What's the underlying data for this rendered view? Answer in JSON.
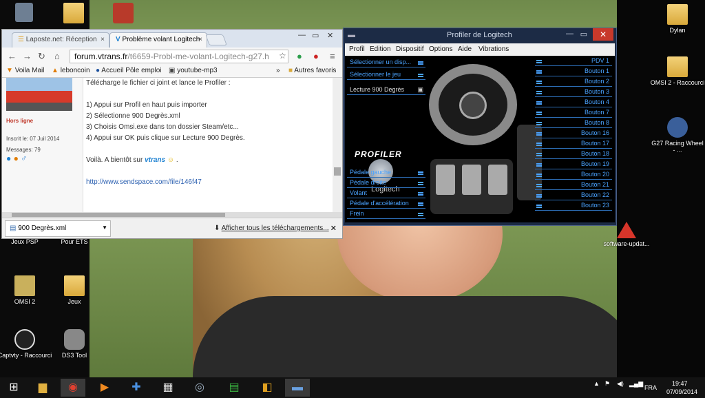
{
  "desktop": {
    "icons": [
      {
        "label": "Dylan"
      },
      {
        "label": "OMSI 2 - Raccourci"
      },
      {
        "label": "G27 Racing Wheel - ..."
      },
      {
        "label": "software-updat..."
      },
      {
        "label": "Jeux PSP"
      },
      {
        "label": "Pour ETS"
      },
      {
        "label": "OMSI 2"
      },
      {
        "label": "Jeux"
      },
      {
        "label": "Captvty - Raccourci"
      },
      {
        "label": "DS3 Tool"
      }
    ]
  },
  "browser": {
    "tabs": [
      {
        "label": "Laposte.net: Réception"
      },
      {
        "label": "Problème volant Logitech"
      }
    ],
    "close_tab": "×",
    "url_host": "forum.vtrans.fr",
    "url_path": "/t6659-Probl-me-volant-Logitech-g27.h",
    "bookmarks": [
      "Voila Mail",
      "leboncoin",
      "Accueil Pôle emploi",
      "youtube-mp3",
      "»",
      "Autres favoris"
    ],
    "sidebar": {
      "status": "Hors ligne",
      "joined": "Inscrit le: 07 Juil 2014",
      "messages": "Messages: 79"
    },
    "post": {
      "lines": [
        "Télécharge le fichier ci joint et lance le Profiler :",
        "",
        "1) Appui sur Profil en haut puis importer",
        "2) Sélectionne 900 Degrès.xml",
        "3) Choisis Omsi.exe dans ton dossier Steam/etc...",
        "4) Appui sur OK puis clique sur Lecture 900 Degrès.",
        "",
        "Voilà. A bientôt sur"
      ],
      "vtrans_logo": "vtrans",
      "link": "http://www.sendspace.com/file/146f47"
    },
    "download": {
      "file": "900 Degrès.xml",
      "show_all": "Afficher tous les téléchargements..."
    }
  },
  "profiler": {
    "title": "Profiler de Logitech",
    "close": "✕",
    "menu": [
      "Profil",
      "Edition",
      "Dispositif",
      "Options",
      "Aide",
      "Vibrations"
    ],
    "left_top": [
      "Sélectionner un disp...",
      "Sélectionner le jeu",
      "Lecture 900 Degrès"
    ],
    "left_bottom": [
      "Pédale gauche",
      "Pédale droite",
      "Volant",
      "Pédale d'accélération",
      "Frein"
    ],
    "right": [
      "PDV 1",
      "Bouton 1",
      "Bouton 2",
      "Bouton 3",
      "Bouton 4",
      "Bouton 7",
      "Bouton 8",
      "Bouton 16",
      "Bouton 17",
      "Bouton 18",
      "Bouton 19",
      "Bouton 20",
      "Bouton 21",
      "Bouton 22",
      "Bouton 23"
    ],
    "brand": "PROFILER",
    "logo": "Logitech"
  },
  "taskbar": {
    "lang": "FRA",
    "time": "19:47",
    "date": "07/09/2014"
  }
}
